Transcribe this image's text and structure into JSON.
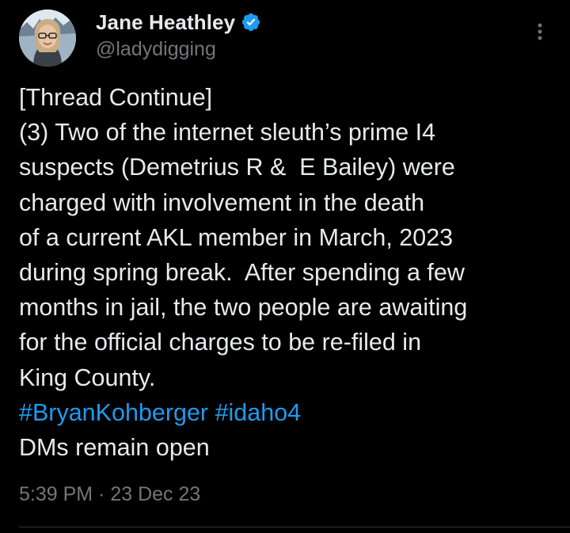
{
  "author": {
    "display_name": "Jane Heathley",
    "handle": "@ladydigging",
    "verified": true
  },
  "icons": {
    "verified": "verified-badge-icon",
    "more": "more-vertical-icon"
  },
  "tweet": {
    "lines": [
      "[Thread Continue]",
      "(3) Two of the internet sleuth’s prime I4",
      "suspects (Demetrius R &  E Bailey) were",
      "charged with involvement in the death",
      "of a current AKL member in March, 2023",
      "during spring break.  After spending a few",
      "months in jail, the two people are awaiting",
      "for the official charges to be re-filed in",
      "King County."
    ],
    "hashtags": [
      "#BryanKohberger",
      "#idaho4"
    ],
    "closing": "DMs remain open"
  },
  "meta": {
    "time": "5:39 PM",
    "separator": " · ",
    "date": "23 Dec 23"
  },
  "colors": {
    "background": "#000000",
    "text": "#e7e9ea",
    "secondary": "#71767b",
    "link": "#1d9bf0"
  }
}
